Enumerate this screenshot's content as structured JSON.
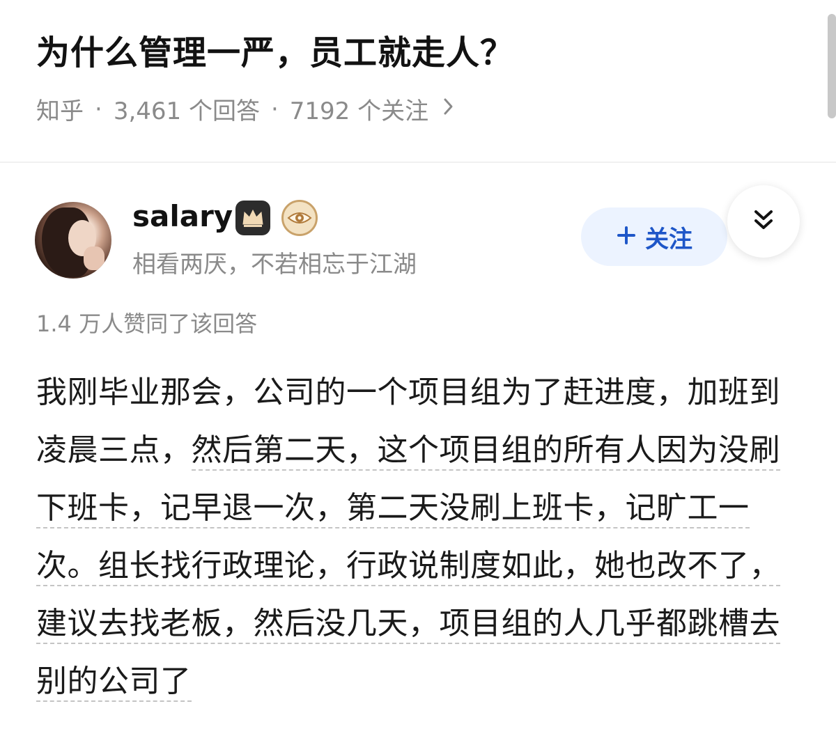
{
  "question": {
    "title": "为什么管理一严，员工就走人？",
    "source": "知乎",
    "answers_count": "3,461 个回答",
    "followers_count": "7192 个关注",
    "separator": "·",
    "chevron_icon": "chevron-right-icon"
  },
  "author": {
    "name": "salary",
    "bio": "相看两厌，不若相忘于江湖",
    "badges": [
      "crown-badge-icon",
      "eye-badge-icon"
    ],
    "follow_label": "关注",
    "follow_icon": "plus-icon",
    "collapse_icon": "double-chevron-down-icon"
  },
  "answer": {
    "vote_text": "1.4 万人赞同了该回答",
    "lead_text": "我刚毕业那会，公司的一个项目组为了赶进度，加班到凌晨三点，",
    "highlight_text": "然后第二天，这个项目组的所有人因为没刷下班卡，记早退一次，第二天没刷上班卡，记旷工一次。组长找行政理论，行政说制度如此，她也改不了，建议去找老板，然后没几天，项目组的人几乎都跳槽去别的公司了"
  },
  "colors": {
    "accent": "#1e56c8",
    "follow_bg": "#ecf3ff",
    "meta_gray": "#8a8a8a",
    "title_text": "#121212"
  }
}
